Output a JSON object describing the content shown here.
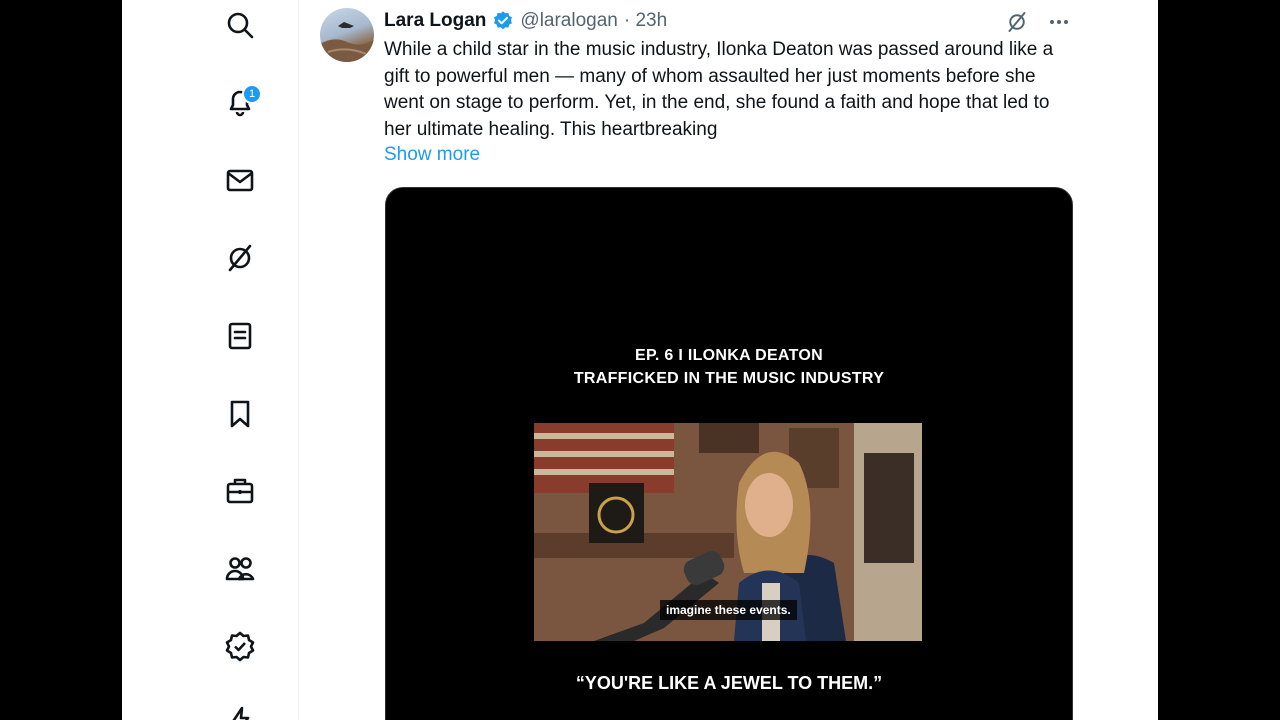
{
  "nav": {
    "notification_count": "1",
    "items": [
      "search-icon",
      "notifications-icon",
      "messages-icon",
      "grok-icon",
      "lists-icon",
      "bookmarks-icon",
      "jobs-icon",
      "communities-icon",
      "verified-icon",
      "lightning-icon"
    ]
  },
  "tweet": {
    "name": "Lara Logan",
    "handle": "@laralogan",
    "time": "· 23h",
    "text": "While a child star in the music industry, Ilonka Deaton was passed around like a gift to powerful men — many of whom assaulted her just moments before she went on stage to perform. Yet, in the end, she found a faith and hope that led to her ultimate healing. This heartbreaking",
    "show_more": "Show more"
  },
  "video": {
    "title_line1": "EP. 6 I ILONKA DEATON",
    "title_line2": "TRAFFICKED IN THE MUSIC INDUSTRY",
    "caption": "imagine these events.",
    "quote": "“YOU'RE LIKE A JEWEL TO THEM.”"
  },
  "colors": {
    "accent": "#1d9bf0",
    "text": "#0f1419",
    "secondary": "#536471"
  }
}
